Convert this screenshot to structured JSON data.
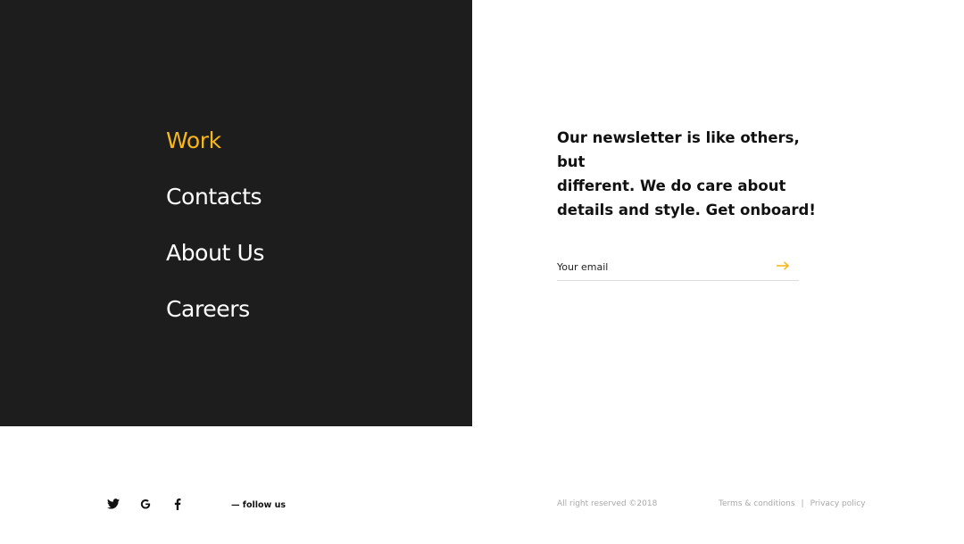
{
  "menu": {
    "items": [
      {
        "label": "Work",
        "active": true
      },
      {
        "label": "Contacts",
        "active": false
      },
      {
        "label": "About Us",
        "active": false
      },
      {
        "label": "Careers",
        "active": false
      }
    ]
  },
  "newsletter": {
    "text": "Our newsletter is like others, but\ndifferent.  We do care about\ndetails and style. Get onboard!",
    "email_placeholder": "Your email",
    "email_value": "",
    "submit_icon": "arrow-right-icon"
  },
  "footer": {
    "social_icons": [
      "twitter-icon",
      "google-icon",
      "facebook-icon"
    ],
    "follow_label": "— follow us",
    "copyright": "All right reserved ©2018",
    "terms_label": "Terms & conditions",
    "separator": "|",
    "privacy_label": "Privacy policy"
  },
  "colors": {
    "accent": "#f5b71c",
    "dark_panel": "#1d1d1d",
    "text_dark": "#111111",
    "muted": "#a9a9a9"
  }
}
